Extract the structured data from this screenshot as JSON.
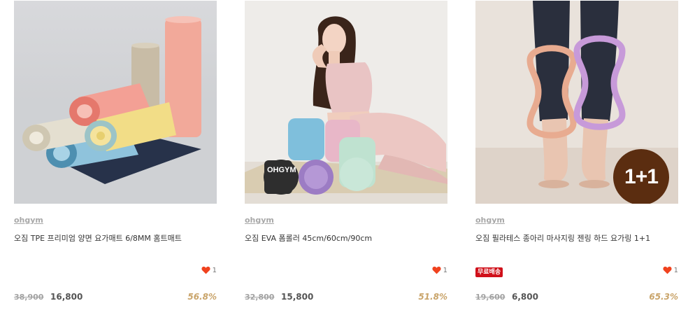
{
  "products": [
    {
      "brand": "ohgym",
      "title": "오짐 TPE 프리미엄 양면 요가매트 6/8MM 홈트매트",
      "likes": "1",
      "original_price": "38,900",
      "sale_price": "16,800",
      "discount": "56.8%",
      "image_icon": "yoga-mat-product-image"
    },
    {
      "brand": "ohgym",
      "title": "오짐 EVA 폼롤러 45cm/60cm/90cm",
      "likes": "1",
      "original_price": "32,800",
      "sale_price": "15,800",
      "discount": "51.8%",
      "image_icon": "foam-roller-product-image",
      "roller_logo": "OHGYM"
    },
    {
      "brand": "ohgym",
      "title": "오짐 필라테스 종아리 마사지링 젠링 하드 요가링 1+1",
      "likes": "1",
      "badge": "무료배송",
      "original_price": "19,600",
      "sale_price": "6,800",
      "discount": "65.3%",
      "promo": "1+1",
      "image_icon": "yoga-ring-product-image"
    }
  ],
  "colors": {
    "heart": "#f0421e",
    "badge": "#d0101a",
    "discount": "#c9a46a",
    "promo_circle": "#5b2d10"
  }
}
